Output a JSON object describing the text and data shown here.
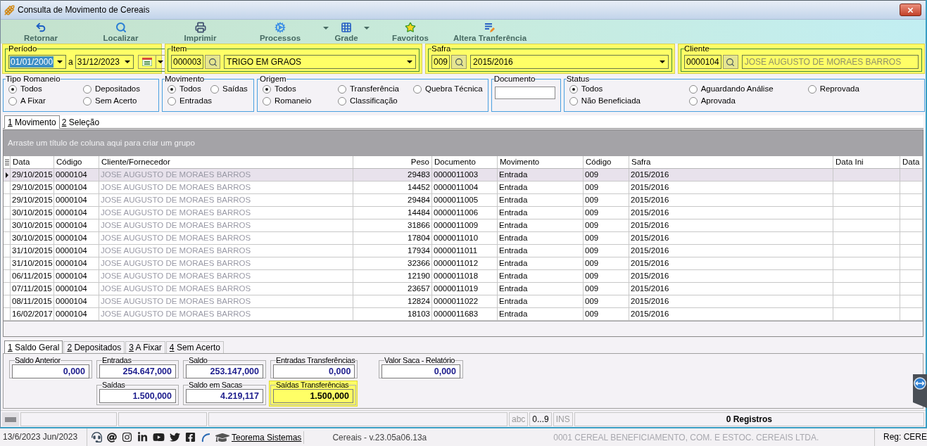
{
  "window": {
    "title": "Consulta de Movimento de Cereais"
  },
  "toolbar": [
    {
      "label": "Retornar",
      "dropdown": false
    },
    {
      "label": "Localizar",
      "dropdown": false
    },
    {
      "label": "Imprimir",
      "dropdown": false
    },
    {
      "label": "Processos",
      "dropdown": true
    },
    {
      "label": "Grade",
      "dropdown": true
    },
    {
      "label": "Favoritos",
      "dropdown": false
    },
    {
      "label": "Altera Tranferência",
      "dropdown": false
    }
  ],
  "filters": [
    {
      "kind": "period",
      "label": "Período",
      "highlighted": true,
      "start": {
        "value": "01/01/2000",
        "text_selected": true
      },
      "separator": "a",
      "end": {
        "value": "31/12/2023",
        "text_selected": false
      }
    },
    {
      "kind": "lookup",
      "label": "Item",
      "highlighted": true,
      "code": "000003",
      "name": "TRIGO EM GRAOS",
      "dropdown": true
    },
    {
      "kind": "lookup",
      "label": "Safra",
      "highlighted": true,
      "code": "009",
      "name": "2015/2016",
      "dropdown": true
    },
    {
      "kind": "lookup",
      "label": "Cliente",
      "highlighted": true,
      "code": "0000104",
      "name": "JOSE AUGUSTO DE MORAES BARROS",
      "dropdown": false
    }
  ],
  "option_groups": [
    {
      "kind": "radio_group",
      "label": "Tipo Romaneio",
      "options": [
        {
          "label": "Todos",
          "selected": true
        },
        {
          "label": "Depositados",
          "selected": false
        },
        {
          "label": "A Fixar",
          "selected": false
        },
        {
          "label": "Sem Acerto",
          "selected": false
        }
      ]
    },
    {
      "kind": "radio_group",
      "label": "Movimento",
      "options": [
        {
          "label": "Todos",
          "selected": true
        },
        {
          "label": "Saídas",
          "selected": false
        },
        {
          "label": "Entradas",
          "selected": false
        }
      ]
    },
    {
      "kind": "radio_group",
      "label": "Origem",
      "options": [
        {
          "label": "Todos",
          "selected": true
        },
        {
          "label": "Transferência",
          "selected": false
        },
        {
          "label": "Quebra Técnica",
          "selected": false
        },
        {
          "label": "Romaneio",
          "selected": false
        },
        {
          "label": "Classificação",
          "selected": false
        }
      ]
    },
    {
      "kind": "text_field",
      "label": "Documento"
    },
    {
      "kind": "radio_group",
      "label": "Status",
      "options": [
        {
          "label": "Todos",
          "selected": true
        },
        {
          "label": "Aguardando Análise",
          "selected": false
        },
        {
          "label": "Reprovada",
          "selected": false
        },
        {
          "label": "Não Beneficiada",
          "selected": false
        },
        {
          "label": "Aprovada",
          "selected": false
        }
      ]
    }
  ],
  "grid": {
    "tabs": [
      {
        "key": "1",
        "label": "Movimento",
        "selected": true
      },
      {
        "key": "2",
        "label": "Seleção",
        "selected": false
      }
    ],
    "group_hint": "Arraste um título de coluna aqui para criar um grupo",
    "columns": [
      "Data",
      "Código",
      "Cliente/Fornecedor",
      "Peso",
      "Documento",
      "Movimento",
      "Código",
      "Safra",
      "Data Ini",
      "Data"
    ],
    "rows": [
      {
        "selected": true,
        "cells": [
          "29/10/2015",
          "0000104",
          "JOSE AUGUSTO DE MORAES BARROS",
          "29483",
          "0000011003",
          "Entrada",
          "009",
          "2015/2016"
        ]
      },
      {
        "selected": false,
        "cells": [
          "29/10/2015",
          "0000104",
          "JOSE AUGUSTO DE MORAES BARROS",
          "14452",
          "0000011004",
          "Entrada",
          "009",
          "2015/2016"
        ]
      },
      {
        "selected": false,
        "cells": [
          "29/10/2015",
          "0000104",
          "JOSE AUGUSTO DE MORAES BARROS",
          "29484",
          "0000011005",
          "Entrada",
          "009",
          "2015/2016"
        ]
      },
      {
        "selected": false,
        "cells": [
          "30/10/2015",
          "0000104",
          "JOSE AUGUSTO DE MORAES BARROS",
          "14484",
          "0000011006",
          "Entrada",
          "009",
          "2015/2016"
        ]
      },
      {
        "selected": false,
        "cells": [
          "30/10/2015",
          "0000104",
          "JOSE AUGUSTO DE MORAES BARROS",
          "31866",
          "0000011009",
          "Entrada",
          "009",
          "2015/2016"
        ]
      },
      {
        "selected": false,
        "cells": [
          "30/10/2015",
          "0000104",
          "JOSE AUGUSTO DE MORAES BARROS",
          "17804",
          "0000011010",
          "Entrada",
          "009",
          "2015/2016"
        ]
      },
      {
        "selected": false,
        "cells": [
          "31/10/2015",
          "0000104",
          "JOSE AUGUSTO DE MORAES BARROS",
          "17934",
          "0000011011",
          "Entrada",
          "009",
          "2015/2016"
        ]
      },
      {
        "selected": false,
        "cells": [
          "31/10/2015",
          "0000104",
          "JOSE AUGUSTO DE MORAES BARROS",
          "32366",
          "0000011012",
          "Entrada",
          "009",
          "2015/2016"
        ]
      },
      {
        "selected": false,
        "cells": [
          "06/11/2015",
          "0000104",
          "JOSE AUGUSTO DE MORAES BARROS",
          "12190",
          "0000011018",
          "Entrada",
          "009",
          "2015/2016"
        ]
      },
      {
        "selected": false,
        "cells": [
          "07/11/2015",
          "0000104",
          "JOSE AUGUSTO DE MORAES BARROS",
          "23657",
          "0000011019",
          "Entrada",
          "009",
          "2015/2016"
        ]
      },
      {
        "selected": false,
        "cells": [
          "08/11/2015",
          "0000104",
          "JOSE AUGUSTO DE MORAES BARROS",
          "12824",
          "0000011022",
          "Entrada",
          "009",
          "2015/2016"
        ]
      },
      {
        "selected": false,
        "cells": [
          "16/02/2017",
          "0000104",
          "JOSE AUGUSTO DE MORAES BARROS",
          "18103",
          "0000011683",
          "Entrada",
          "009",
          "2015/2016"
        ]
      }
    ]
  },
  "summary_tabs": [
    {
      "key": "1",
      "label": "Saldo Geral",
      "selected": true
    },
    {
      "key": "2",
      "label": "Depositados",
      "selected": false
    },
    {
      "key": "3",
      "label": "A Fixar",
      "selected": false
    },
    {
      "key": "4",
      "label": "Sem Acerto",
      "selected": false
    }
  ],
  "summary": {
    "fields": [
      {
        "label": "Saldo Anterior",
        "value": "0,000",
        "highlighted": false
      },
      {
        "label": "Entradas",
        "value": "254.647,000",
        "highlighted": false
      },
      {
        "label": "Saldo",
        "value": "253.147,000",
        "highlighted": false
      },
      {
        "label": "Entradas Transferências",
        "value": "0,000",
        "highlighted": false
      },
      {
        "label": "Valor Saca - Relatório",
        "value": "0,000",
        "highlighted": false
      },
      {
        "label": "Saídas",
        "value": "1.500,000",
        "highlighted": false
      },
      {
        "label": "Saldo em Sacas",
        "value": "4.219,117",
        "highlighted": false
      },
      {
        "label": "Saídas Transferências",
        "value": "1.500,000",
        "highlighted": true
      }
    ]
  },
  "status_bar": {
    "indicators": [
      {
        "label": "abc",
        "on": false
      },
      {
        "label": "0...9",
        "on": true
      },
      {
        "label": "INS",
        "on": false
      }
    ],
    "record_count": "0 Registros"
  },
  "footer": {
    "date": "13/6/2023 Jun/2023",
    "link": "Teorema Sistemas",
    "version": "Cereais - v.23.05a06.13a",
    "company": "0001 CEREAL BENEFICIAMENTO, COM. E ESTOC. CEREAIS LTDA.",
    "registration": "Reg: CERE"
  }
}
